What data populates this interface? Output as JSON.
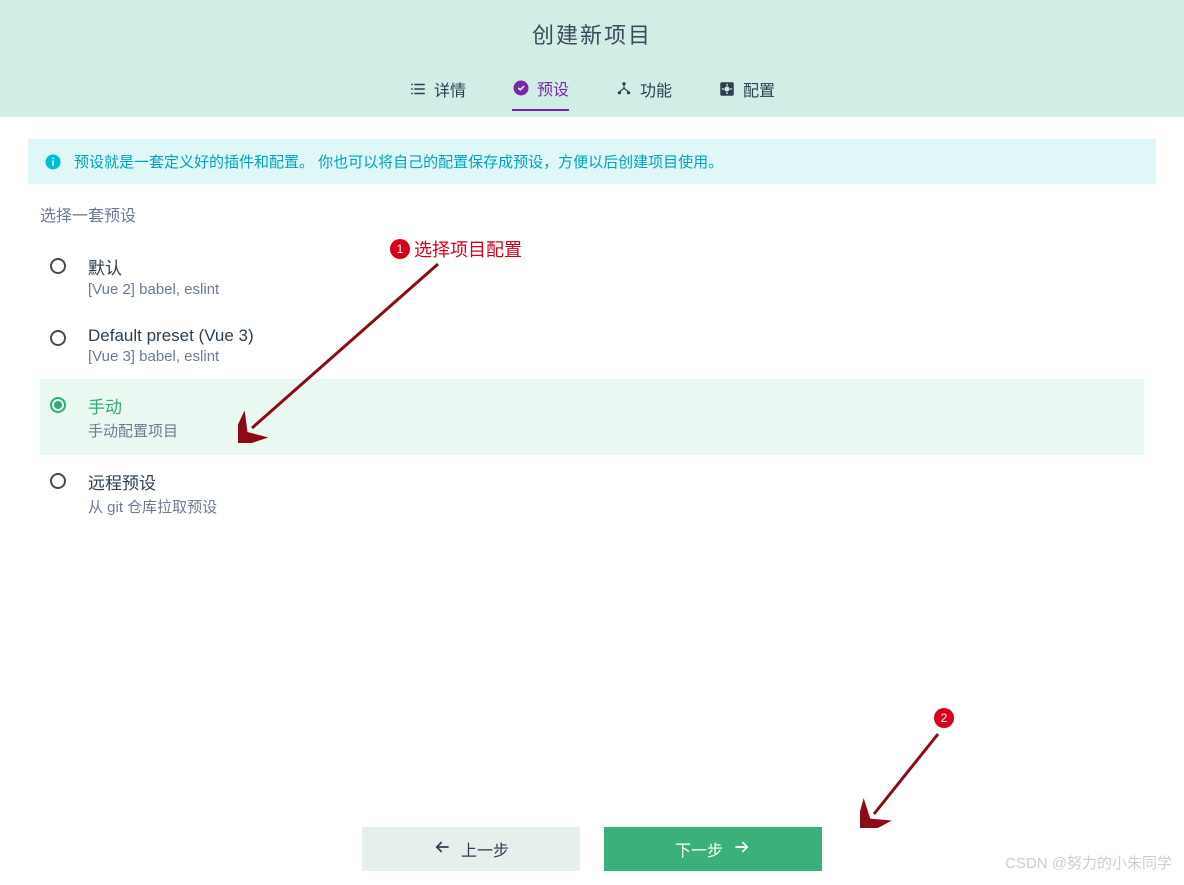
{
  "header": {
    "title": "创建新项目",
    "tabs": [
      {
        "label": "详情"
      },
      {
        "label": "预设"
      },
      {
        "label": "功能"
      },
      {
        "label": "配置"
      }
    ]
  },
  "info": "预设就是一套定义好的插件和配置。 你也可以将自己的配置保存成预设，方便以后创建项目使用。",
  "section_title": "选择一套预设",
  "presets": [
    {
      "title": "默认",
      "subtitle": "[Vue 2] babel, eslint"
    },
    {
      "title": "Default preset (Vue 3)",
      "subtitle": "[Vue 3] babel, eslint"
    },
    {
      "title": "手动",
      "subtitle": "手动配置项目"
    },
    {
      "title": "远程预设",
      "subtitle": "从 git 仓库拉取预设"
    }
  ],
  "annotations": {
    "one": "1",
    "one_text": "选择项目配置",
    "two": "2"
  },
  "footer": {
    "prev": "上一步",
    "next": "下一步"
  },
  "watermark": "CSDN @努力的小朱同学"
}
